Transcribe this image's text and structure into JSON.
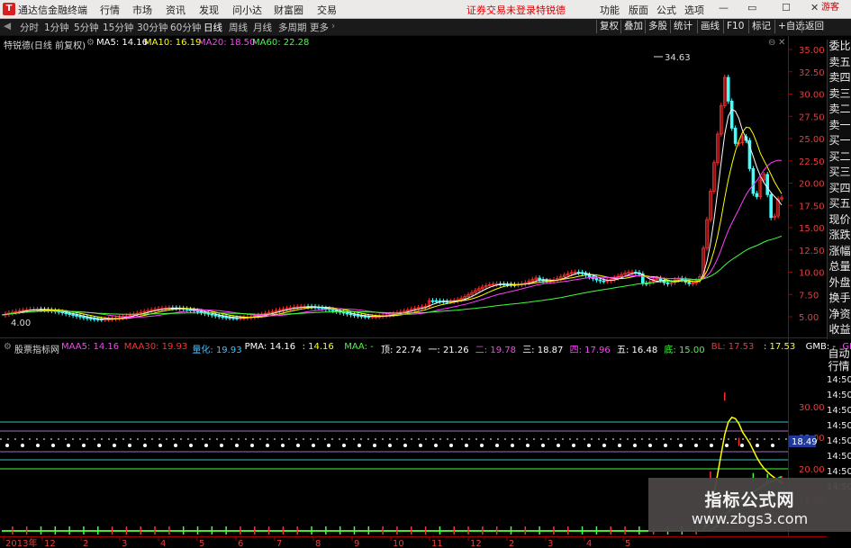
{
  "titlebar": {
    "app_name": "通达信金融终端",
    "menus": [
      "行情",
      "市场",
      "资讯",
      "发现",
      "问小达",
      "财富圈",
      "交易"
    ],
    "notice": "证券交易未登录",
    "stock_name": "特锐德",
    "right_menus": [
      "功能",
      "版面",
      "公式",
      "选项"
    ],
    "guest": "游客"
  },
  "toolbar": {
    "periods": [
      "分时",
      "1分钟",
      "5分钟",
      "15分钟",
      "30分钟",
      "60分钟",
      "日线",
      "周线",
      "月线",
      "多周期",
      "更多"
    ],
    "active_period": "日线",
    "right_buttons": [
      "复权",
      "叠加",
      "多股",
      "统计",
      "画线",
      "F10",
      "标记",
      "+自选",
      "返回"
    ]
  },
  "main_chart": {
    "title": "特锐德(日线 前复权)",
    "ma": [
      {
        "label": "MA5: 14.16",
        "color": "#ffffff"
      },
      {
        "label": "MA10: 16.19",
        "color": "#ffff00"
      },
      {
        "label": "MA20: 18.50",
        "color": "#ff40ff"
      },
      {
        "label": "MA60: 22.28",
        "color": "#40ff40"
      }
    ],
    "y_ticks": [
      "35.00",
      "32.50",
      "30.00",
      "27.50",
      "25.00",
      "22.50",
      "20.00",
      "17.50",
      "15.00",
      "12.50",
      "10.00",
      "7.50",
      "5.00"
    ],
    "high_label": "34.63",
    "low_label": "4.00"
  },
  "indicator_chart": {
    "title": "股票指标网",
    "items": [
      {
        "label": "MAA5: 14.16",
        "color": "#ff40ff"
      },
      {
        "label": "MAA30: 19.93",
        "color": "#ff3030"
      },
      {
        "label": "量化: 19.93",
        "color": "#40c0ff"
      },
      {
        "label": "PMA: 14.16",
        "color": "#ffffff"
      },
      {
        "label": ": 14.16",
        "color": "#ffff00"
      },
      {
        "label": "MAA: -",
        "color": "#40ff40"
      },
      {
        "label": "顶: 22.74",
        "color": "#ffffff"
      },
      {
        "label": "一: 21.26",
        "color": "#ffffff"
      },
      {
        "label": "二: 19.78",
        "color": "#ff40ff"
      },
      {
        "label": "三: 18.87",
        "color": "#ffffff"
      },
      {
        "label": "四: 17.96",
        "color": "#ff40ff"
      },
      {
        "label": "五: 16.48",
        "color": "#ffffff"
      },
      {
        "label": "底: 15.00",
        "color": "#40ff40"
      },
      {
        "label": "BL: 17.53",
        "color": "#ff3030"
      },
      {
        "label": ": 17.53",
        "color": "#ffff00"
      },
      {
        "label": "GMB: -",
        "color": "#ffffff"
      },
      {
        "label": "GMC: -",
        "color": "#ff40ff"
      }
    ],
    "y_ticks": [
      "30.00",
      "25.00",
      "20.00",
      "15.00"
    ],
    "current_value": "18.49"
  },
  "x_axis": [
    "2013年",
    "12",
    "2",
    "3",
    "4",
    "5",
    "6",
    "7",
    "8",
    "9",
    "10",
    "11",
    "12",
    "2",
    "3",
    "4",
    "5"
  ],
  "side_panel": {
    "top_items": [
      "委比",
      "卖五",
      "卖四",
      "卖三",
      "卖二",
      "卖一",
      "买一",
      "买二",
      "买三",
      "买四",
      "买五",
      "现价",
      "涨跌",
      "涨幅",
      "总量",
      "外盘",
      "换手",
      "净资",
      "收益"
    ],
    "bottom_items": [
      "自动",
      "行情"
    ],
    "times": [
      "14:50",
      "14:50",
      "14:50",
      "14:50",
      "14:50",
      "14:50",
      "14:50",
      "14:50"
    ]
  },
  "watermark": {
    "line1": "指标公式网",
    "line2": "www.zbgs3.com"
  },
  "colors": {
    "up": "#ff3030",
    "down": "#40ffff",
    "ma5": "#ffffff",
    "ma10": "#ffff00",
    "ma20": "#ff40ff",
    "ma60": "#40ff40",
    "axis": "#9a0000"
  }
}
